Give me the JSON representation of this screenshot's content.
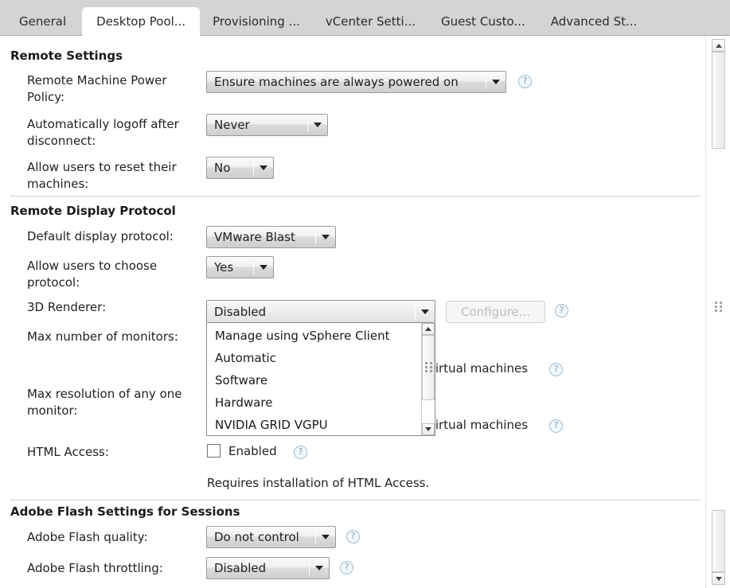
{
  "window": {
    "tabs": [
      {
        "label": "General",
        "active": false
      },
      {
        "label": "Desktop Pool...",
        "active": true
      },
      {
        "label": "Provisioning ...",
        "active": false
      },
      {
        "label": "vCenter Setti...",
        "active": false
      },
      {
        "label": "Guest Custo...",
        "active": false
      },
      {
        "label": "Advanced St...",
        "active": false
      }
    ]
  },
  "sections": {
    "remote_settings": {
      "title": "Remote Settings",
      "fields": {
        "power_policy": {
          "label": "Remote Machine Power Policy:",
          "value": "Ensure machines are always powered on"
        },
        "auto_logoff": {
          "label": "Automatically logoff after disconnect:",
          "value": "Never"
        },
        "allow_reset": {
          "label": "Allow users to reset their machines:",
          "value": "No"
        }
      }
    },
    "remote_display_protocol": {
      "title": "Remote Display Protocol",
      "fields": {
        "default_protocol": {
          "label": "Default display protocol:",
          "value": "VMware Blast"
        },
        "allow_choose": {
          "label": "Allow users to choose protocol:",
          "value": "Yes"
        },
        "renderer_3d": {
          "label": "3D Renderer:",
          "value": "Disabled",
          "configure_label": "Configure...",
          "options": [
            "Manage using vSphere Client",
            "Automatic",
            "Software",
            "Hardware",
            "NVIDIA GRID VGPU"
          ]
        },
        "max_monitors": {
          "label": "Max number of monitors:",
          "suffix": "virtual machines"
        },
        "max_resolution": {
          "label": "Max resolution of any one monitor:",
          "suffix": "virtual machines"
        },
        "html_access": {
          "label": "HTML Access:",
          "checkbox_label": "Enabled",
          "note": "Requires installation of HTML Access."
        }
      }
    },
    "adobe_flash": {
      "title": "Adobe Flash Settings for Sessions",
      "fields": {
        "flash_quality": {
          "label": "Adobe Flash quality:",
          "value": "Do not control"
        },
        "flash_throttling": {
          "label": "Adobe Flash throttling:",
          "value": "Disabled"
        }
      }
    }
  },
  "icons": {
    "help": "?"
  },
  "colors": {
    "tabbar_bg": "#d4d4d4",
    "active_tab_bg": "#ffffff",
    "help_ring": "#9fbdd4",
    "divider": "#d0d0d0"
  }
}
